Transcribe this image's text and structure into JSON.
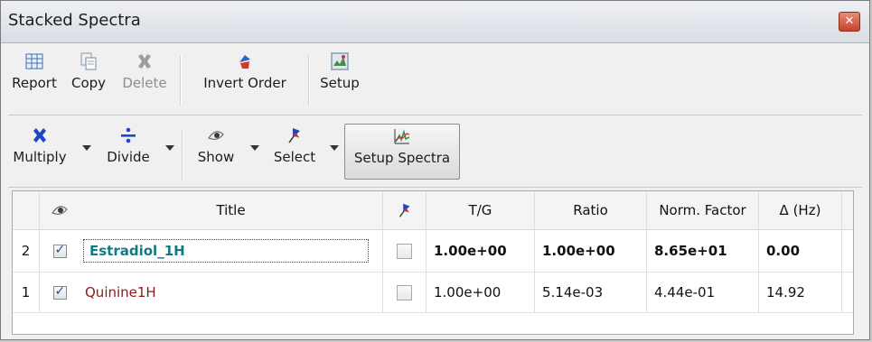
{
  "window": {
    "title": "Stacked Spectra",
    "close_symbol": "✕"
  },
  "toolbar1": {
    "report": "Report",
    "copy": "Copy",
    "delete": "Delete",
    "invert_order": "Invert Order",
    "setup": "Setup"
  },
  "toolbar2": {
    "multiply": "Multiply",
    "divide": "Divide",
    "show": "Show",
    "select": "Select",
    "setup_spectra": "Setup Spectra"
  },
  "table": {
    "headers": {
      "title": "Title",
      "tg": "T/G",
      "ratio": "Ratio",
      "norm": "Norm. Factor",
      "delta": "Δ (Hz)"
    },
    "rows": [
      {
        "index": "2",
        "visible": true,
        "title": "Estradiol_1H",
        "pinned": false,
        "tg": "1.00e+00",
        "ratio": "1.00e+00",
        "norm": "8.65e+01",
        "delta": "0.00",
        "active": true
      },
      {
        "index": "1",
        "visible": true,
        "title": "Quinine1H",
        "pinned": false,
        "tg": "1.00e+00",
        "ratio": "5.14e-03",
        "norm": "4.44e-01",
        "delta": "14.92",
        "active": false
      }
    ]
  },
  "colors": {
    "active_title": "#127a82",
    "inactive_title": "#8b1b1b"
  }
}
